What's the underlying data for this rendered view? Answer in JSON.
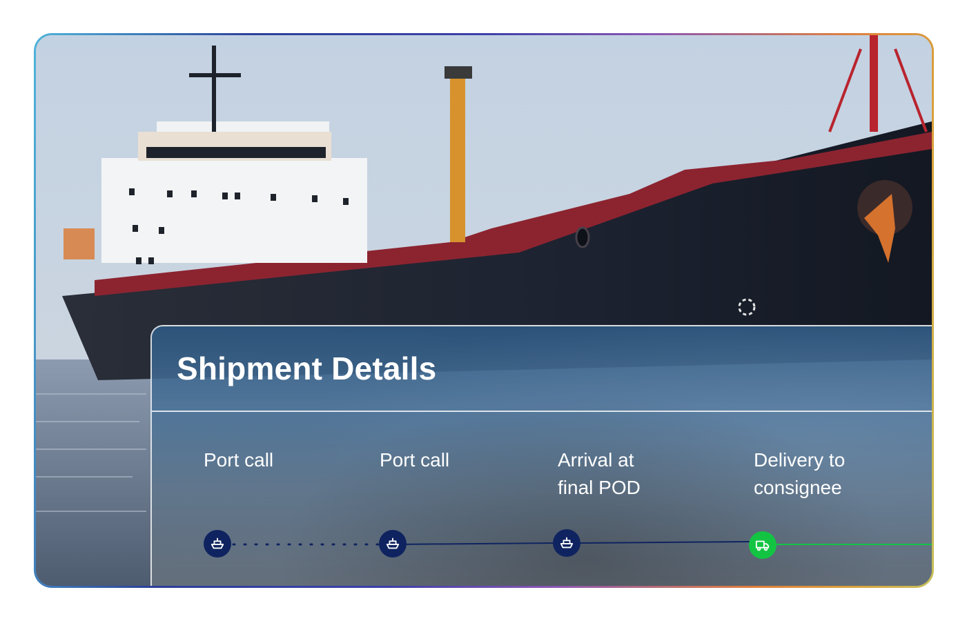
{
  "card": {
    "title": "Shipment Details"
  },
  "timeline": {
    "steps": [
      {
        "label": "Port call",
        "icon": "ship-icon",
        "status": "completed"
      },
      {
        "label": "Port call",
        "icon": "ship-icon",
        "status": "completed"
      },
      {
        "label": "Arrival at\nfinal POD",
        "icon": "ship-icon",
        "status": "completed"
      },
      {
        "label": "Delivery to\nconsignee",
        "icon": "truck-icon",
        "status": "active"
      }
    ],
    "colors": {
      "completed": "#0f2360",
      "active": "#13c443"
    }
  }
}
